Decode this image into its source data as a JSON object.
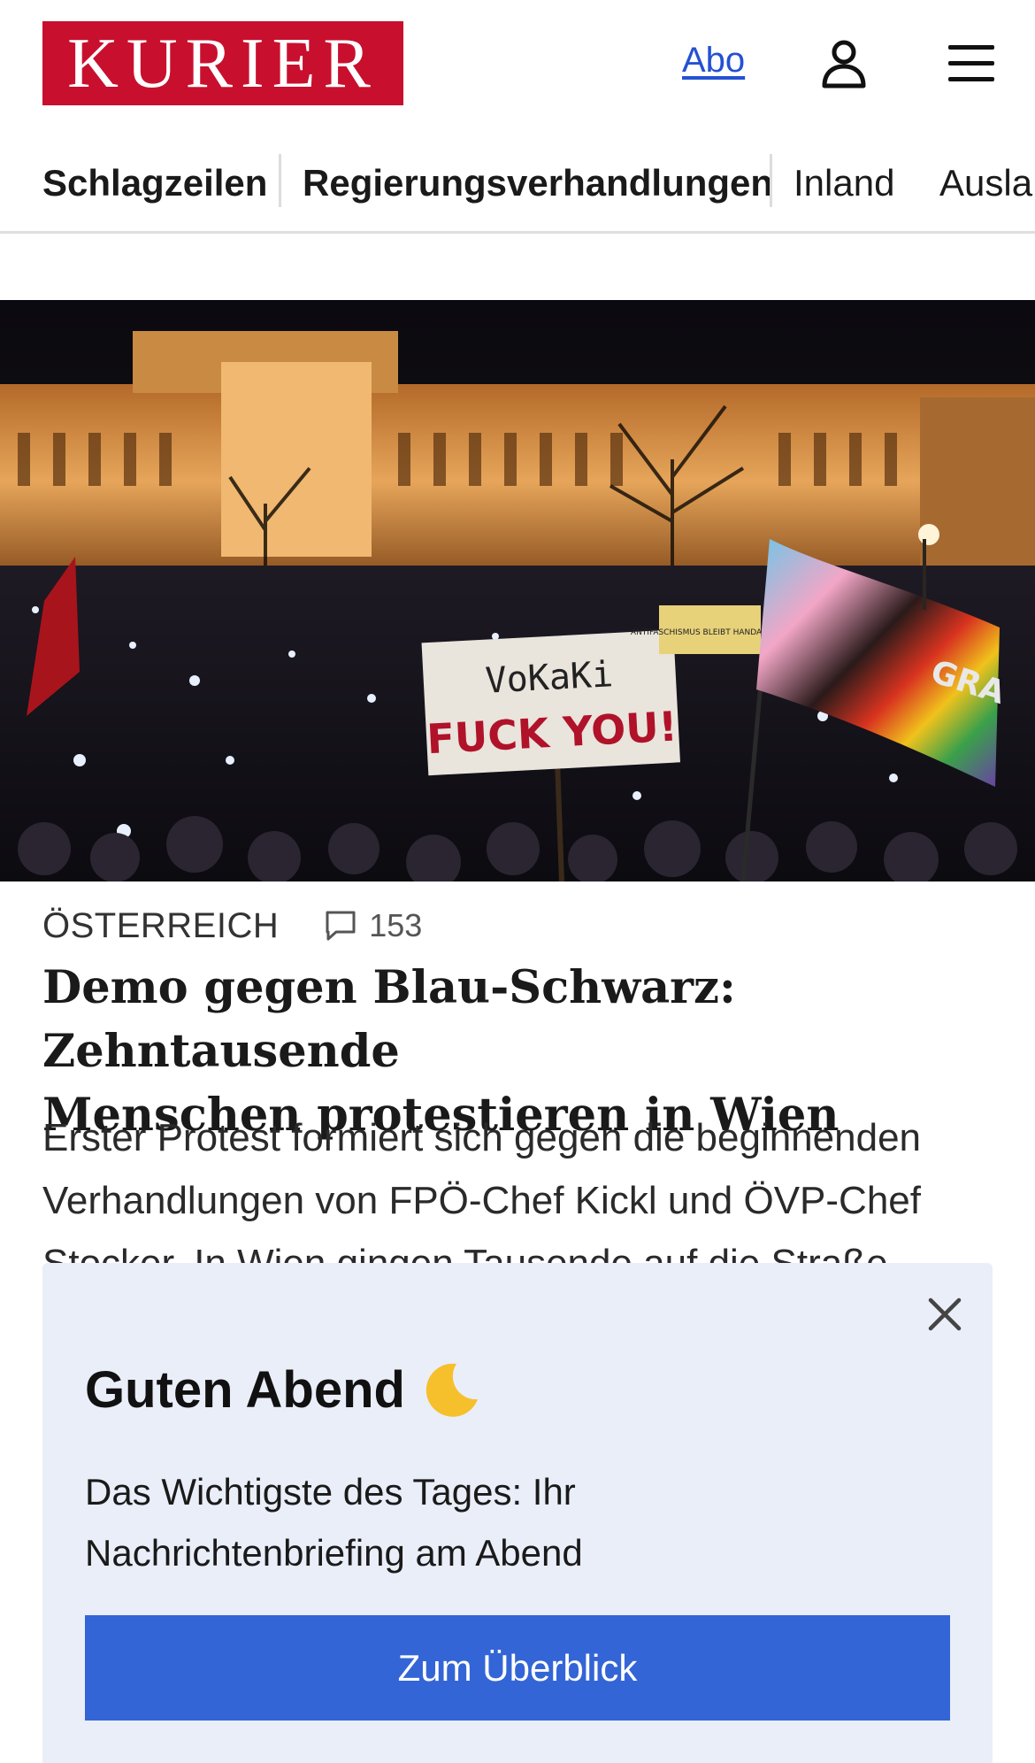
{
  "header": {
    "logo_text": "KURIER",
    "abo_label": "Abo",
    "user_icon": "user-icon",
    "menu_icon": "hamburger-menu-icon"
  },
  "nav": {
    "items": [
      {
        "label": "Schlagzeilen",
        "bold": true
      },
      {
        "label": "Regierungsverhandlungen",
        "bold": true
      },
      {
        "label": "Inland",
        "bold": false
      },
      {
        "label": "Ausla",
        "bold": false
      }
    ]
  },
  "hero": {
    "sign_line1": "VoKaKi",
    "sign_line2": "FUCK YOU!",
    "sign_small": "ANTIFASCHISMUS BLEIBT HANDARBEIT!",
    "flag_text": "GRA"
  },
  "article": {
    "kicker": "ÖSTERREICH",
    "comment_count": "153",
    "headline_line1": "Demo gegen Blau-Schwarz: Zehntausende",
    "headline_line2": "Menschen protestieren in Wien",
    "teaser_line1": "Erster Protest formiert sich gegen die beginnenden",
    "teaser_line2": "Verhandlungen von FPÖ-Chef Kickl und ÖVP-Chef",
    "teaser_line3": "Stocker. In Wien gingen Tausende auf die Straße."
  },
  "popup": {
    "greeting": "Guten Abend",
    "text_line1": "Das Wichtigste des Tages: Ihr",
    "text_line2": "Nachrichtenbriefing am Abend",
    "cta_label": "Zum Überblick",
    "close_icon": "close-icon",
    "moon_icon": "crescent-moon-icon"
  },
  "colors": {
    "brand_red": "#c8102e",
    "link_blue": "#2451d3",
    "cta_blue": "#3465d6",
    "popup_bg": "#eaeef9"
  }
}
